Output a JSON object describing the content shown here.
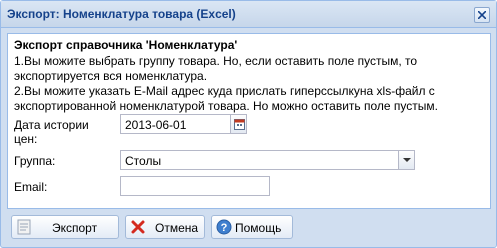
{
  "window": {
    "title": "Экспорт: Номенклатура товара (Excel)"
  },
  "panel": {
    "heading": "Экспорт справочника 'Номенклатура'",
    "lines": [
      "1.Вы можите выбрать группу товара. Но, если оставить поле пустым, то",
      "экспортируется вся номенклатура.",
      "2.Вы можите указать E-Mail адрес куда прислать гиперссылкуна xls-файл с",
      "экспортированной номенклатурой товара. Но можно оставить поле пустым."
    ]
  },
  "form": {
    "date_label_1": "Дата истории",
    "date_label_2": "цен:",
    "date_value": "2013-06-01",
    "group_label": "Группа:",
    "group_value": "Столы",
    "email_label": "Email:",
    "email_value": ""
  },
  "buttons": {
    "export": "Экспорт",
    "cancel": "Отмена",
    "help": "Помощь"
  }
}
